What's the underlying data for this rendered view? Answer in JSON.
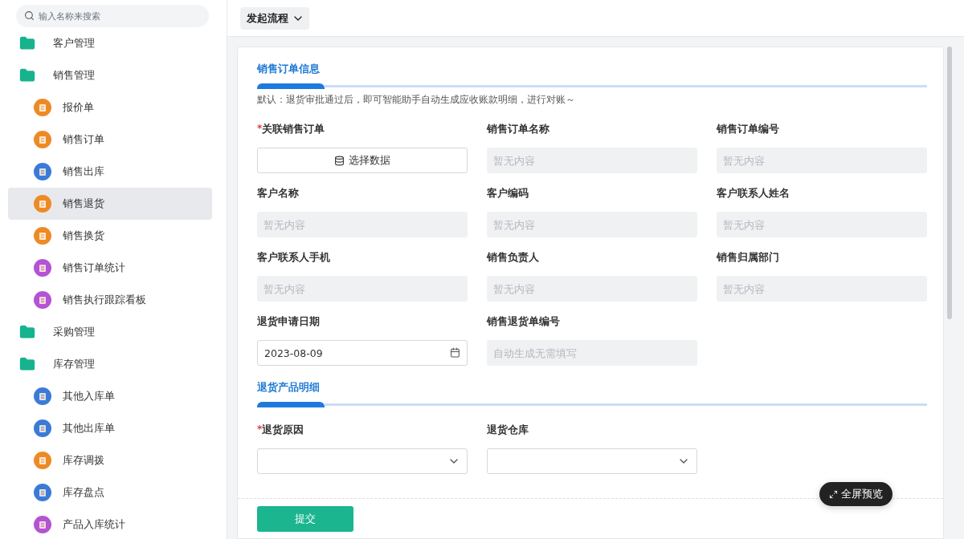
{
  "sidebar": {
    "search": {
      "placeholder": "输入名称来搜索"
    },
    "items": [
      {
        "kind": "folder",
        "label": "客户管理",
        "selected": false
      },
      {
        "kind": "folder",
        "label": "销售管理",
        "selected": false,
        "children": [
          {
            "kind": "form",
            "label": "报价单",
            "selected": false
          },
          {
            "kind": "form",
            "label": "销售订单",
            "selected": false
          },
          {
            "kind": "list",
            "label": "销售出库",
            "selected": false
          },
          {
            "kind": "form",
            "label": "销售退货",
            "selected": true
          },
          {
            "kind": "form",
            "label": "销售换货",
            "selected": false
          },
          {
            "kind": "report",
            "label": "销售订单统计",
            "selected": false
          },
          {
            "kind": "report",
            "label": "销售执行跟踪看板",
            "selected": false
          }
        ]
      },
      {
        "kind": "folder",
        "label": "采购管理",
        "selected": false
      },
      {
        "kind": "folder",
        "label": "库存管理",
        "selected": false,
        "children": [
          {
            "kind": "list",
            "label": "其他入库单",
            "selected": false
          },
          {
            "kind": "list",
            "label": "其他出库单",
            "selected": false
          },
          {
            "kind": "form",
            "label": "库存调拨",
            "selected": false
          },
          {
            "kind": "list",
            "label": "库存盘点",
            "selected": false
          },
          {
            "kind": "report",
            "label": "产品入库统计",
            "selected": false
          }
        ]
      }
    ]
  },
  "toolbar": {
    "flow_button": "发起流程"
  },
  "form": {
    "sections": [
      {
        "title": "销售订单信息",
        "hint": "默认：退货审批通过后，即可智能助手自动生成应收账款明细，进行对账～",
        "fields": [
          {
            "kind": "picker",
            "label": "关联销售订单",
            "required_mark": "*",
            "button": "选择数据"
          },
          {
            "kind": "readonly",
            "label": "销售订单名称",
            "placeholder": "暂无内容"
          },
          {
            "kind": "readonly",
            "label": "销售订单编号",
            "placeholder": "暂无内容"
          },
          {
            "kind": "readonly",
            "label": "客户名称",
            "placeholder": "暂无内容"
          },
          {
            "kind": "readonly",
            "label": "客户编码",
            "placeholder": "暂无内容"
          },
          {
            "kind": "readonly",
            "label": "客户联系人姓名",
            "placeholder": "暂无内容"
          },
          {
            "kind": "readonly",
            "label": "客户联系人手机",
            "placeholder": "暂无内容"
          },
          {
            "kind": "readonly",
            "label": "销售负责人",
            "placeholder": "暂无内容"
          },
          {
            "kind": "readonly",
            "label": "销售归属部门",
            "placeholder": "暂无内容"
          },
          {
            "kind": "date",
            "label": "退货申请日期",
            "value": "2023-08-09"
          },
          {
            "kind": "readonly",
            "label": "销售退货单编号",
            "placeholder": "自动生成无需填写"
          }
        ]
      },
      {
        "title": "退货产品明细",
        "fields": [
          {
            "kind": "dropdown",
            "label": "退货原因",
            "required_mark": "*"
          },
          {
            "kind": "dropdown",
            "label": "退货仓库"
          }
        ]
      }
    ],
    "submit": "提交"
  },
  "fullscreen_button": "全屏预览"
}
